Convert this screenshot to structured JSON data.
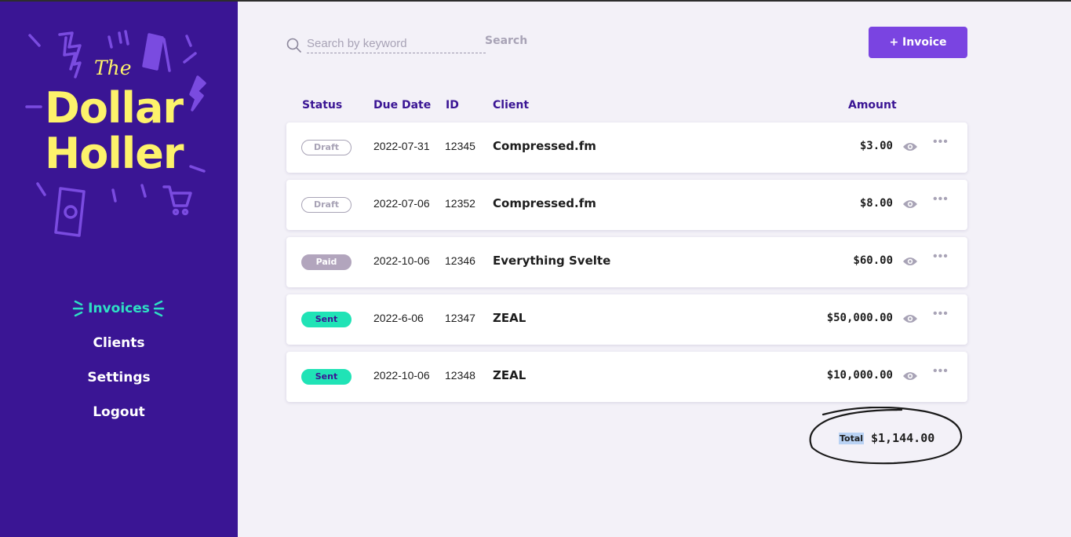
{
  "brand": {
    "the": "The",
    "line1": "Dollar",
    "line2": "Holler"
  },
  "nav": {
    "items": [
      {
        "label": "Invoices",
        "active": true
      },
      {
        "label": "Clients",
        "active": false
      },
      {
        "label": "Settings",
        "active": false
      },
      {
        "label": "Logout",
        "active": false
      }
    ]
  },
  "search": {
    "placeholder": "Search by keyword",
    "value": "",
    "button_label": "Search"
  },
  "actions": {
    "new_invoice_label": "+ Invoice"
  },
  "table": {
    "headers": {
      "status": "Status",
      "due_date": "Due Date",
      "id": "ID",
      "client": "Client",
      "amount": "Amount"
    },
    "rows": [
      {
        "status": "Draft",
        "due_date": "2022-07-31",
        "id": "12345",
        "client": "Compressed.fm",
        "amount": "$3.00"
      },
      {
        "status": "Draft",
        "due_date": "2022-07-06",
        "id": "12352",
        "client": "Compressed.fm",
        "amount": "$8.00"
      },
      {
        "status": "Paid",
        "due_date": "2022-10-06",
        "id": "12346",
        "client": "Everything Svelte",
        "amount": "$60.00"
      },
      {
        "status": "Sent",
        "due_date": "2022-6-06",
        "id": "12347",
        "client": "ZEAL",
        "amount": "$50,000.00"
      },
      {
        "status": "Sent",
        "due_date": "2022-10-06",
        "id": "12348",
        "client": "ZEAL",
        "amount": "$10,000.00"
      }
    ],
    "row_icons": [
      "eye-icon",
      "more-icon"
    ]
  },
  "total": {
    "label": "Total",
    "value": "$1,144.00"
  },
  "colors": {
    "sidebar": "#3a1594",
    "logo": "#fdf26b",
    "active_nav": "#2ee0c4",
    "accent": "#7a44e1",
    "sent": "#20e3b6",
    "paid": "#b2a5bd"
  }
}
